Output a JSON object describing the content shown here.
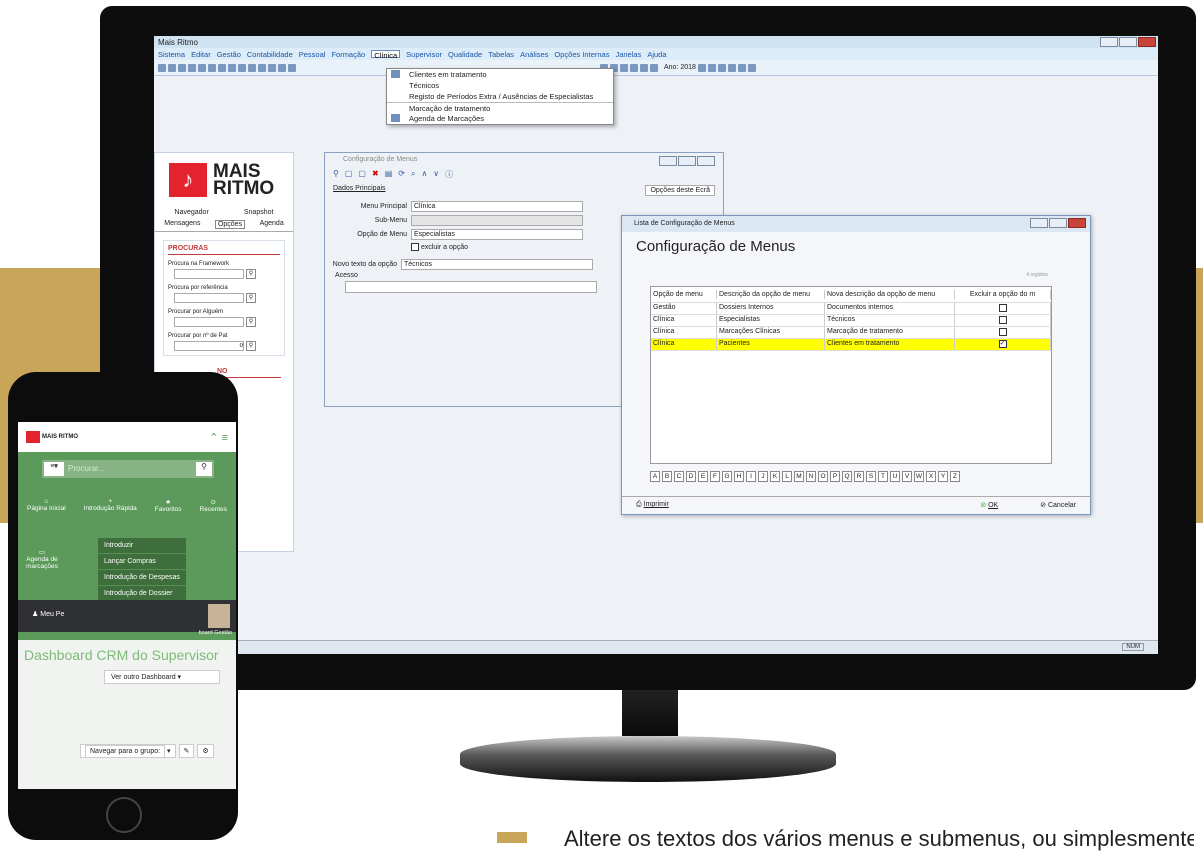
{
  "app": {
    "title": "Mais Ritmo",
    "menu": [
      "Sistema",
      "Editar",
      "Gestão",
      "Contabilidade",
      "Pessoal",
      "Formação",
      "Clínica",
      "Supervisor",
      "Qualidade",
      "Tabelas",
      "Análises",
      "Opções Internas",
      "Janelas",
      "Ajuda"
    ],
    "year_label": "Ano: 2018"
  },
  "dropdown": {
    "items": [
      "Clientes em tratamento",
      "Técnicos",
      "Registo de Períodos Extra / Ausências de Especialistas",
      "Marcação de tratamento",
      "Agenda de Marcações"
    ]
  },
  "sidepanel": {
    "logo_line1": "MAIS",
    "logo_line2": "RITMO",
    "tabs_top": [
      "Navegador",
      "Snapshot"
    ],
    "tabs": [
      "Mensagens",
      "Opções",
      "Agenda"
    ],
    "section_title": "PROCURAS",
    "searches": [
      "Procura na Framework",
      "Procura por referência",
      "Procurar por Alguém",
      "Procurar por nº de Pat"
    ],
    "last_value": "0",
    "section2": "NO"
  },
  "cfg": {
    "title": "Configuração de Menus",
    "tab": "Dados Principais",
    "options": "Opções deste Ecrã",
    "fields": [
      {
        "label": "Menu Principal",
        "value": "Clínica"
      },
      {
        "label": "Sub-Menu",
        "value": ""
      },
      {
        "label": "Opção de Menu",
        "value": "Especialistas"
      }
    ],
    "checkbox": "excluir a opção",
    "new_text_label": "Novo texto da opção",
    "new_text": "Técnicos",
    "access": "Acesso"
  },
  "lista": {
    "title": "Lista de Configuração de Menus",
    "heading": "Configuração de Menus",
    "count": "4 registos",
    "columns": [
      "Opção de menu",
      "Descrição da opção de menu",
      "Nova descrição da opção de menu",
      "Excluir a opção do m"
    ],
    "rows": [
      [
        "Gestão",
        "Dossiers Internos",
        "Documentos internos"
      ],
      [
        "Clínica",
        "Especialistas",
        "Técnicos"
      ],
      [
        "Clínica",
        "Marcações Clínicas",
        "Marcação de tratamento"
      ],
      [
        "Clínica",
        "Pacientes",
        "Clientes em tratamento"
      ]
    ],
    "letters": [
      "A",
      "B",
      "C",
      "D",
      "E",
      "F",
      "G",
      "H",
      "I",
      "J",
      "K",
      "L",
      "M",
      "N",
      "O",
      "P",
      "Q",
      "R",
      "S",
      "T",
      "U",
      "V",
      "W",
      "X",
      "Y",
      "Z"
    ],
    "print": "Imprimir",
    "ok": "OK",
    "cancel": "Cancelar"
  },
  "status": {
    "num": "NUM"
  },
  "phone": {
    "logo": "MAIS RITMO",
    "search": "Procurar...",
    "icons": [
      "Página Inicial",
      "Introdução Rápida",
      "Favoritos",
      "Recentes"
    ],
    "menu": [
      "Introduzir",
      "Lançar Compras",
      "Introdução de Despesas",
      "Introdução de Dossier"
    ],
    "agenda": "Agenda de marcações",
    "user": "Meu Pe",
    "dash_suffix": "board Gestão",
    "dashboard": "Dashboard CRM do Supervisor",
    "other": "Ver outro Dashboard",
    "nav": "Navegar para o grupo:"
  },
  "caption": "Altere os textos dos vários menus e submenus, ou simplesmente"
}
